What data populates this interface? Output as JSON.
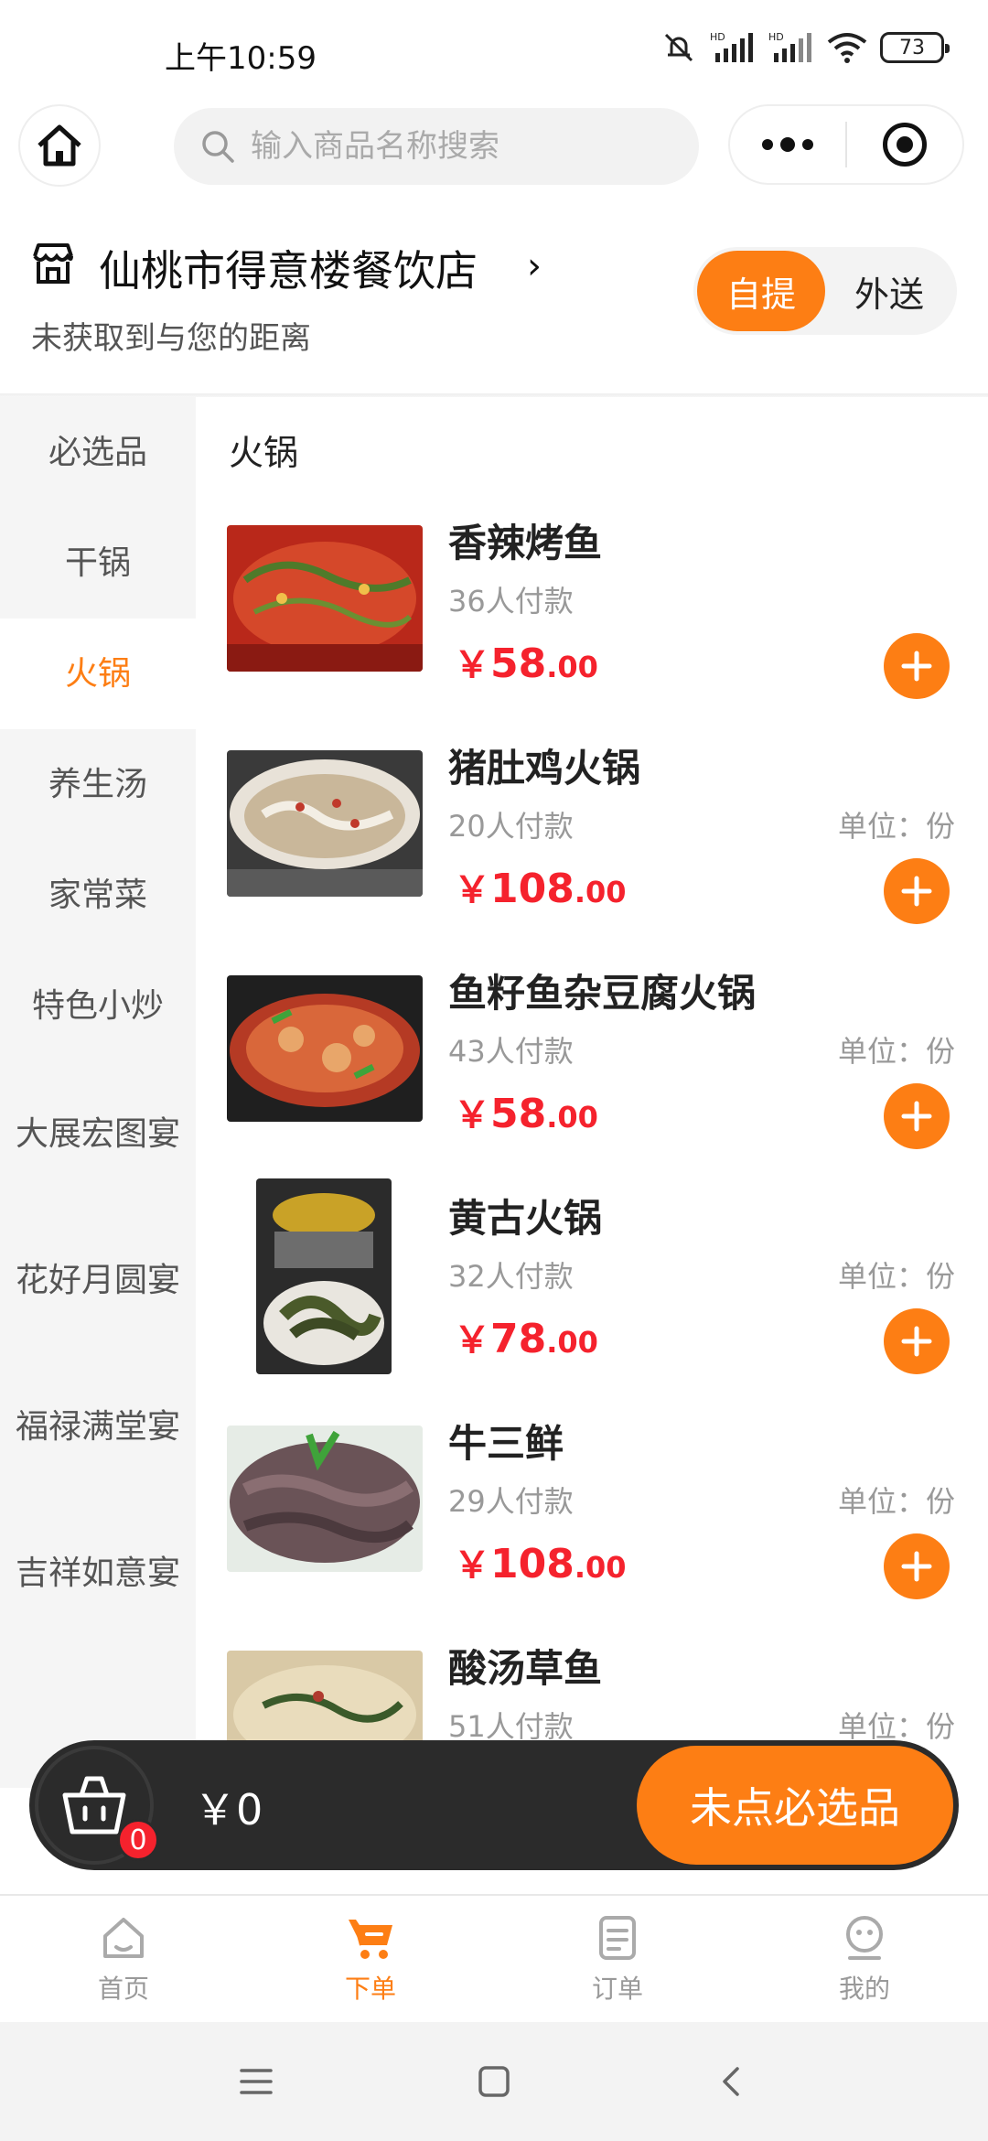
{
  "status_bar": {
    "time": "上午10:59",
    "battery": "73"
  },
  "search": {
    "placeholder": "输入商品名称搜索"
  },
  "store": {
    "name": "仙桃市得意楼餐饮店",
    "arrow": "›",
    "distance": "未获取到与您的距离"
  },
  "delivery_mode": {
    "pickup": "自提",
    "delivery": "外送",
    "selected": "自提"
  },
  "categories": [
    "必选品",
    "干锅",
    "火锅",
    "养生汤",
    "家常菜",
    "特色小炒",
    "大展宏图宴",
    "花好月圆宴",
    "福禄满堂宴",
    "吉祥如意宴"
  ],
  "active_category": "火锅",
  "section_title": "火锅",
  "products": [
    {
      "name": "香辣烤鱼",
      "sold": "36人付款",
      "unit": "",
      "price_int": "58",
      "price_dec": ".00"
    },
    {
      "name": "猪肚鸡火锅",
      "sold": "20人付款",
      "unit": "单位：份",
      "price_int": "108",
      "price_dec": ".00"
    },
    {
      "name": "鱼籽鱼杂豆腐火锅",
      "sold": "43人付款",
      "unit": "单位：份",
      "price_int": "58",
      "price_dec": ".00"
    },
    {
      "name": "黄古火锅",
      "sold": "32人付款",
      "unit": "单位：份",
      "price_int": "78",
      "price_dec": ".00"
    },
    {
      "name": "牛三鲜",
      "sold": "29人付款",
      "unit": "单位：份",
      "price_int": "108",
      "price_dec": ".00"
    },
    {
      "name": "酸汤草鱼",
      "sold": "51人付款",
      "unit": "单位：份",
      "price_int": "",
      "price_dec": ""
    }
  ],
  "currency": "￥",
  "cart": {
    "count": "0",
    "total": "￥0",
    "checkout_label": "未点必选品"
  },
  "tabs": [
    {
      "label": "首页",
      "icon": "home-icon"
    },
    {
      "label": "下单",
      "icon": "cart-icon"
    },
    {
      "label": "订单",
      "icon": "order-icon"
    },
    {
      "label": "我的",
      "icon": "profile-icon"
    }
  ],
  "active_tab": "下单",
  "colors": {
    "accent": "#fd7e14",
    "price": "#f5222d",
    "dark_bar": "#2b2b2b"
  }
}
